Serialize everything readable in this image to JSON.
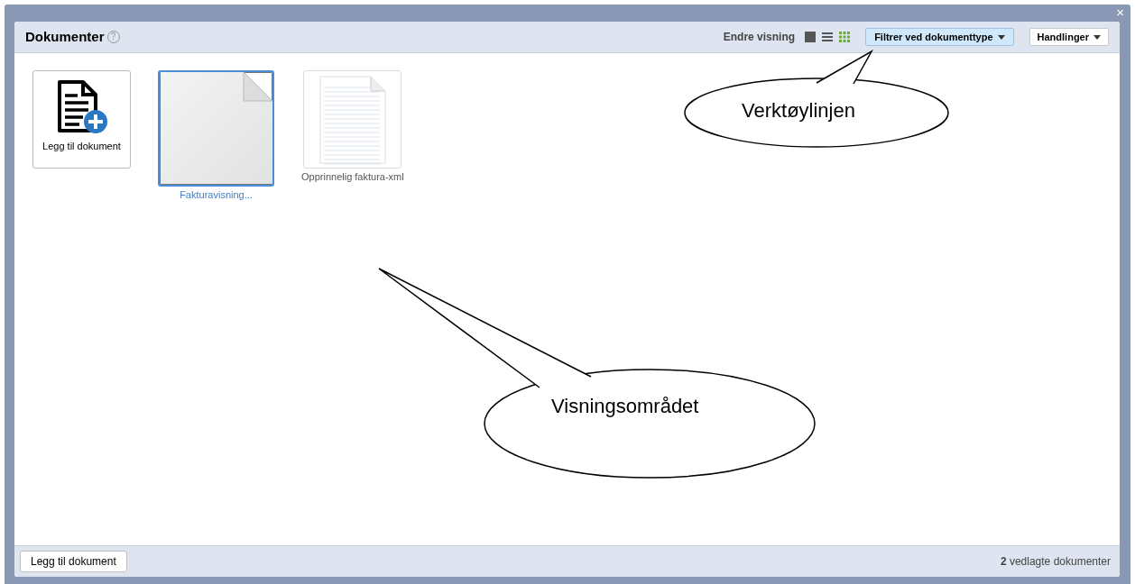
{
  "panel": {
    "title": "Dokumenter",
    "help_icon": "?",
    "close": "×"
  },
  "toolbar": {
    "view_label": "Endre visning",
    "view_modes": [
      {
        "kind": "single",
        "selected": false
      },
      {
        "kind": "list",
        "selected": false
      },
      {
        "kind": "grid",
        "selected": true
      }
    ],
    "filter_button": "Filtrer ved dokumenttype",
    "actions_button": "Handlinger"
  },
  "documents": [
    {
      "kind": "add",
      "label": "Legg til dokument",
      "selected": false
    },
    {
      "kind": "preview",
      "label": "Fakturavisning...",
      "selected": true
    },
    {
      "kind": "lined",
      "label": "Opprinnelig faktura-xml",
      "selected": false
    }
  ],
  "footer": {
    "add_button": "Legg til dokument",
    "status": "**2** vedlagte dokumenter"
  },
  "callouts": [
    "Verktøylinjen",
    "Visningsområdet"
  ]
}
